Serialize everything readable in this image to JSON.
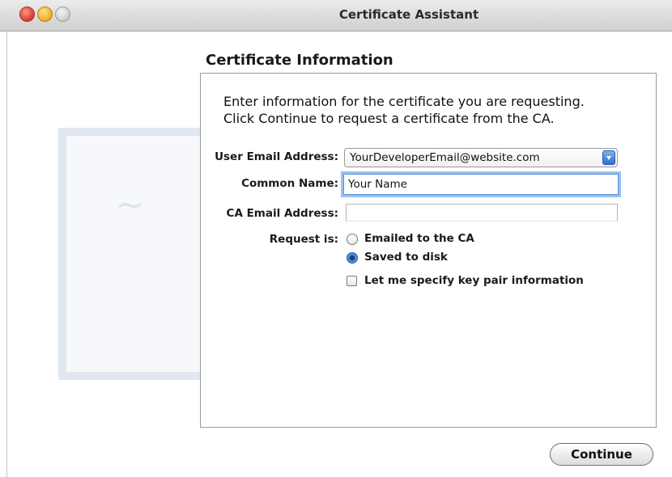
{
  "window": {
    "title": "Certificate Assistant"
  },
  "section": {
    "heading": "Certificate Information"
  },
  "instructions": {
    "line1": "Enter information for the certificate you are requesting.",
    "line2": "Click Continue to request a certificate from the CA."
  },
  "form": {
    "user_email_label": "User Email Address:",
    "user_email_value": "YourDeveloperEmail@website.com",
    "common_name_label": "Common Name:",
    "common_name_value": "Your Name",
    "ca_email_label": "CA Email Address:",
    "ca_email_value": "",
    "request_label": "Request is:",
    "options": [
      {
        "label": "Emailed to the CA",
        "selected": false
      },
      {
        "label": "Saved to disk",
        "selected": true
      }
    ],
    "key_pair_label": "Let me specify key pair information",
    "key_pair_checked": false
  },
  "buttons": {
    "continue_label": "Continue"
  }
}
